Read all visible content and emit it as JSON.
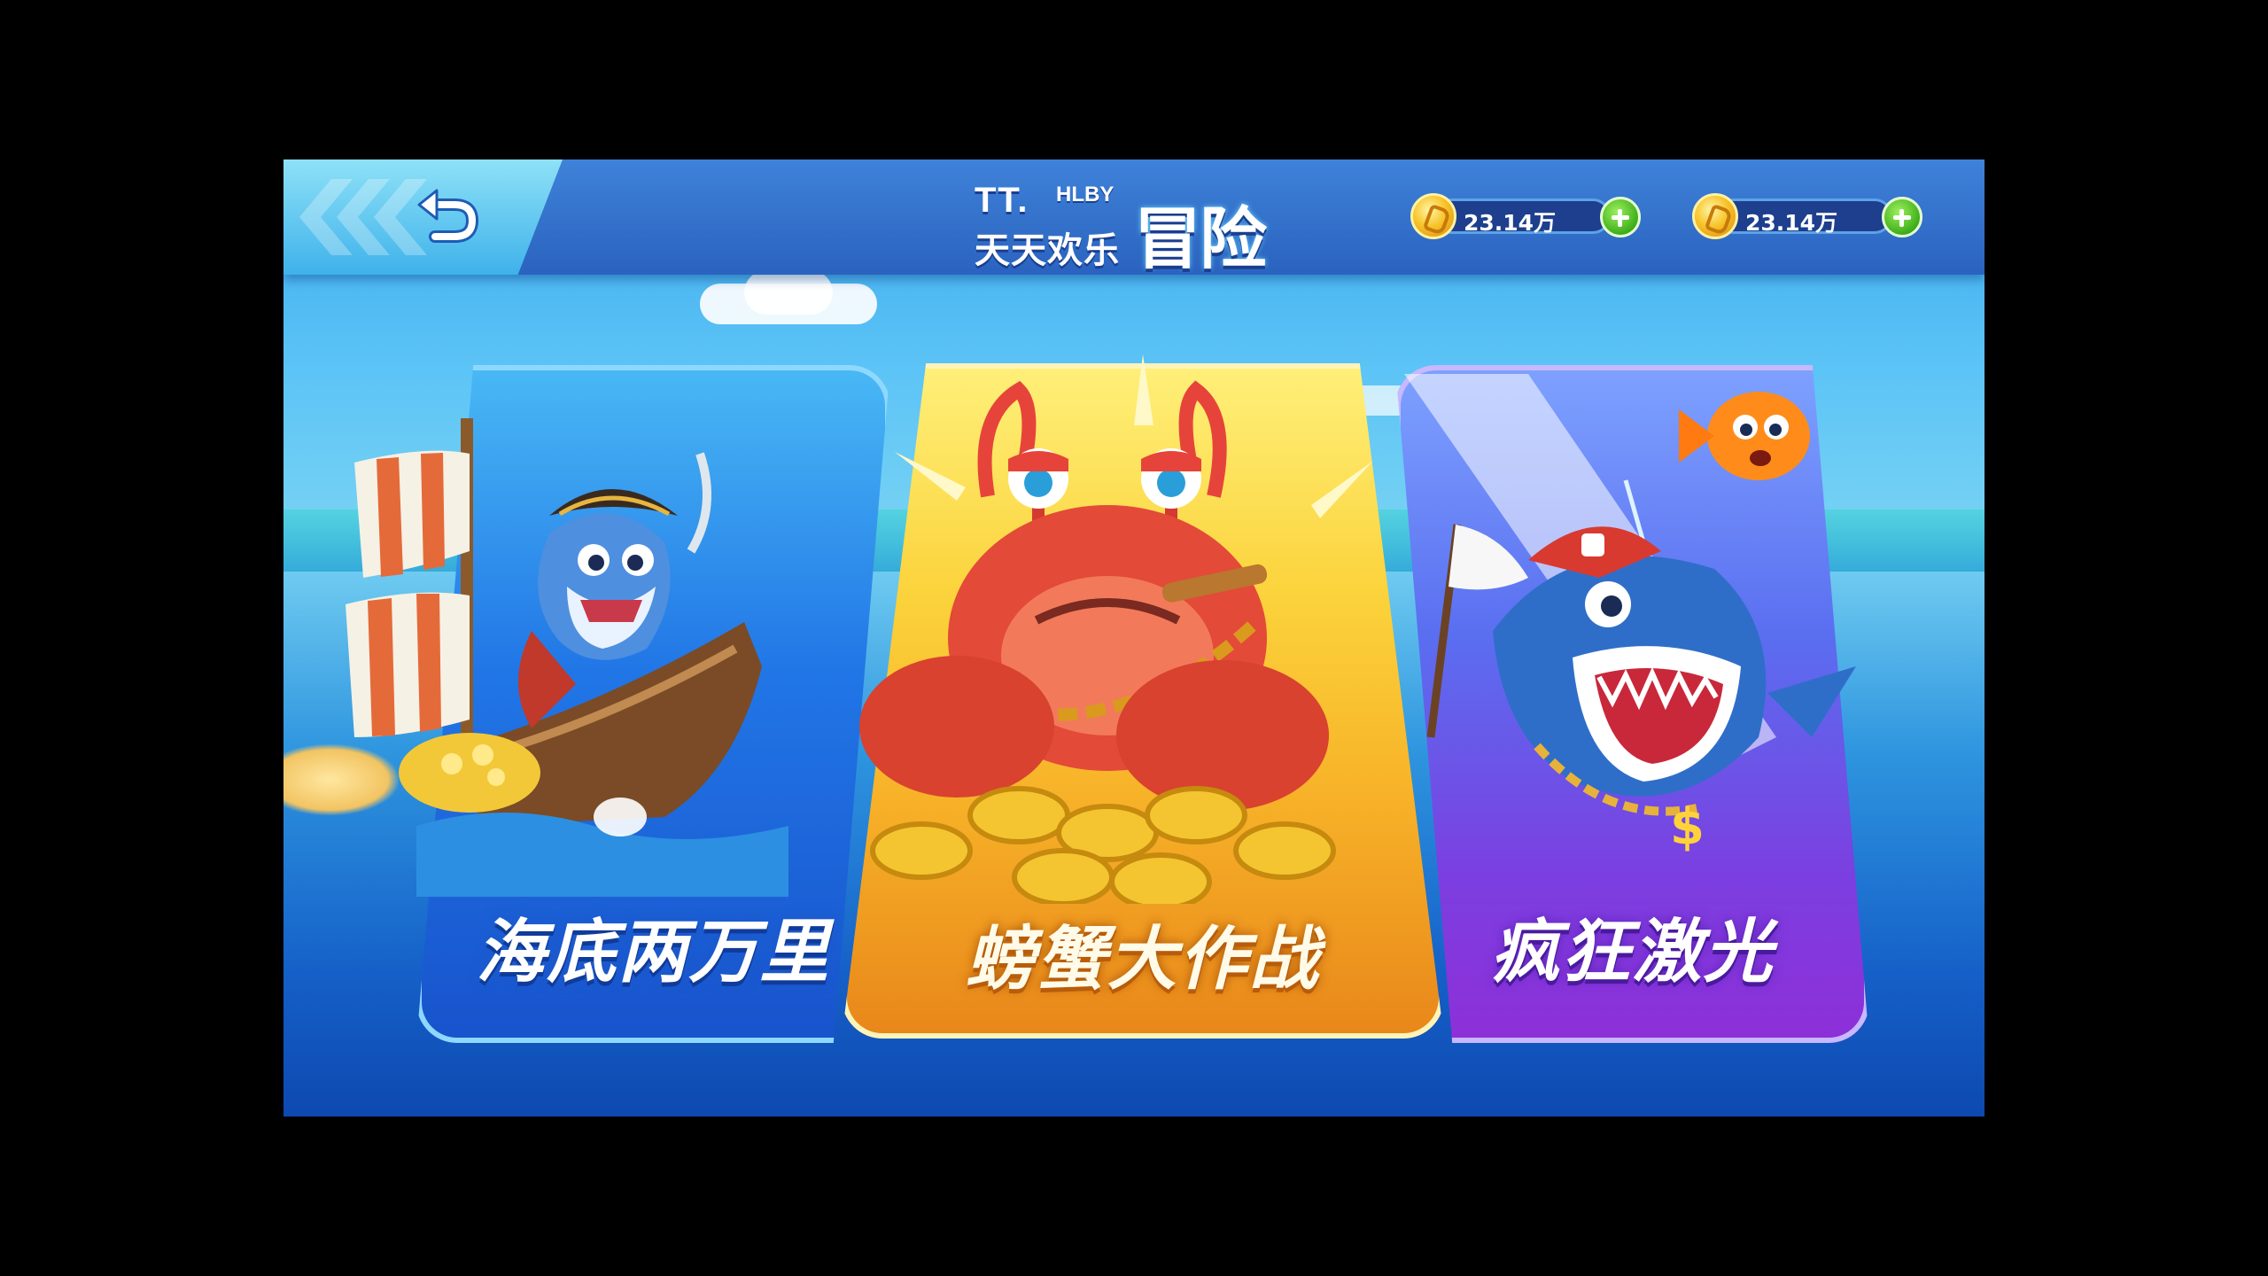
{
  "header": {
    "logo": {
      "tt": "TT.",
      "hlby": "HLBY",
      "subtitle": "天天欢乐",
      "title": "冒险"
    },
    "currencies": [
      {
        "value": "23.14万"
      },
      {
        "value": "23.14万"
      }
    ]
  },
  "modes": [
    {
      "label": "海底两万里",
      "theme_color": "#2176e6"
    },
    {
      "label": "螃蟹大作战",
      "theme_color": "#f7b128"
    },
    {
      "label": "疯狂激光",
      "theme_color": "#7b3fe0"
    }
  ],
  "colors": {
    "topbar": "#2a63bf",
    "coin": "#f8c52c",
    "plus": "#3fae1b"
  }
}
